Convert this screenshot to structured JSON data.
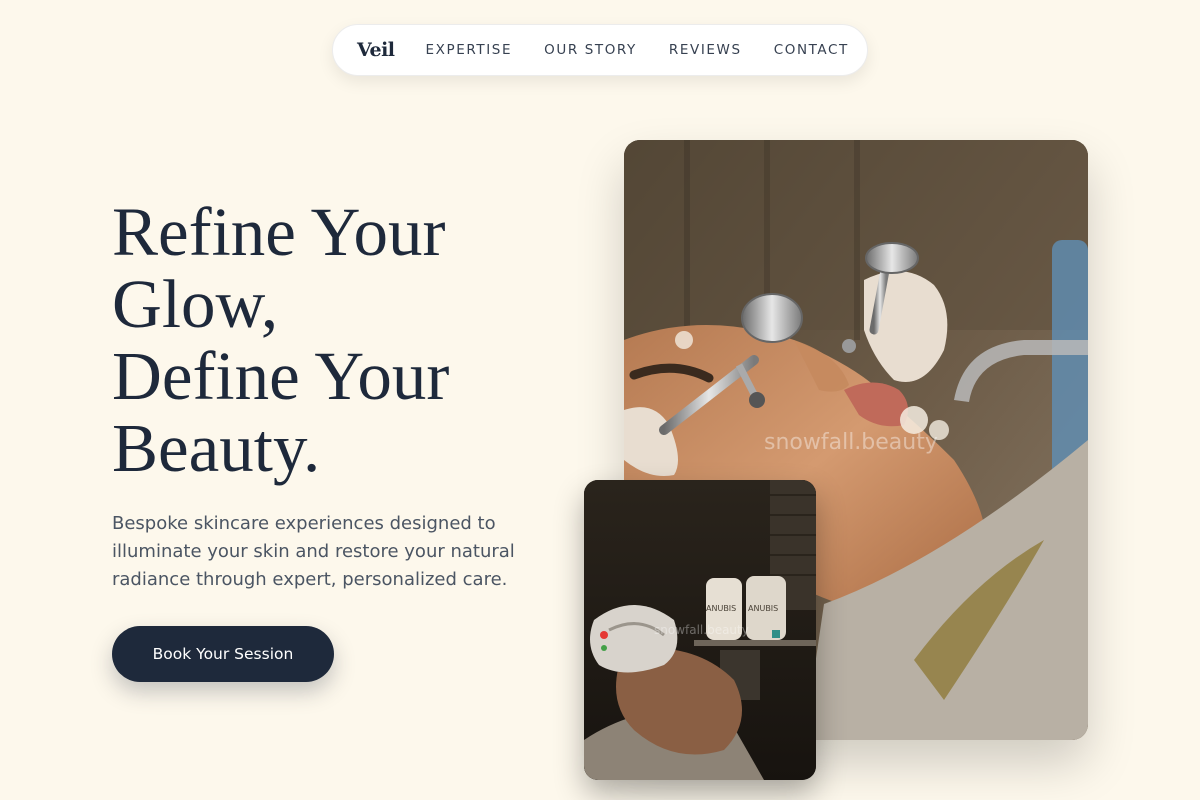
{
  "nav": {
    "brand": "Veil",
    "links": [
      "EXPERTISE",
      "OUR STORY",
      "REVIEWS",
      "CONTACT"
    ]
  },
  "hero": {
    "headline_lines": [
      "Refine Your",
      "Glow,",
      "Define Your",
      "Beauty."
    ],
    "subtext": "Bespoke skincare experiences designed to illuminate your skin and restore your natural radiance through expert, personalized care.",
    "cta_label": "Book Your Session"
  },
  "images": {
    "main_watermark": "snowfall.beauty",
    "small_watermark": "snowfall.beauty",
    "product_label": "ANUBIS"
  },
  "colors": {
    "background": "#fdf8ec",
    "primary": "#1e293b",
    "text_muted": "#4b5563"
  }
}
